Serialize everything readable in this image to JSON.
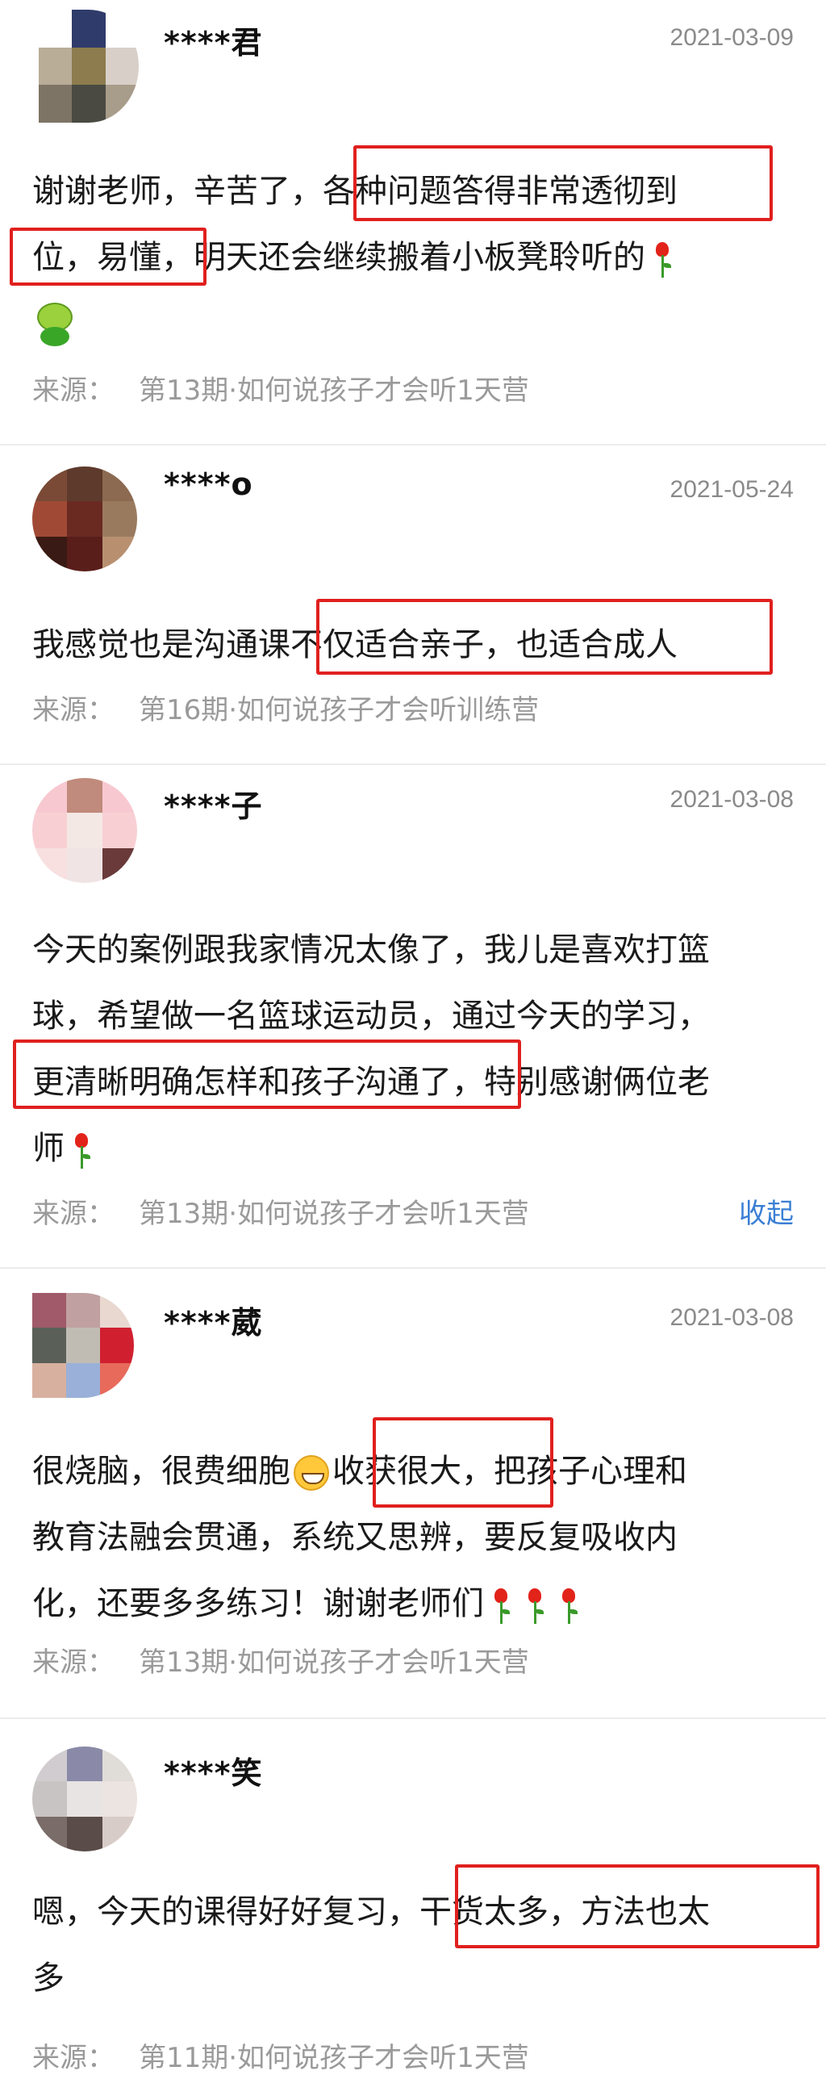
{
  "comments": [
    {
      "name": "****君",
      "date": "2021-03-09",
      "text": "谢谢老师，辛苦了，各种问题答得非常透彻到位，易懂，明天还会继续搬着小板凳聆听的",
      "line1": "谢谢老师，辛苦了，各种问题答得非常透彻到",
      "line2": "位，易懂，明天还会继续搬着小板凳聆听的",
      "source_label": "来源：",
      "source": "第13期·如何说孩子才会听1天营",
      "avatar_colors": [
        "#ffffff",
        "#2f3b6a",
        "#ffffff",
        "#b9ad98",
        "#8c7c4e",
        "#d8d0c8",
        "#7e7466",
        "#4a4a42",
        "#a89c8a"
      ]
    },
    {
      "name": "****o",
      "date": "2021-05-24",
      "line1": "我感觉也是沟通课不仅适合亲子，也适合成人",
      "source_label": "来源：",
      "source": "第16期·如何说孩子才会听训练营",
      "avatar_colors": [
        "#7a4a36",
        "#5e3a2c",
        "#8c6a52",
        "#a04a36",
        "#6a2a22",
        "#9a7a5e",
        "#3a1a14",
        "#5a1e1a",
        "#b89070"
      ]
    },
    {
      "name": "****子",
      "date": "2021-03-08",
      "line1": "今天的案例跟我家情况太像了，我儿是喜欢打篮",
      "line2": "球，希望做一名篮球运动员，通过今天的学习，",
      "line3": "更清晰明确怎样和孩子沟通了，特别感谢俩位老",
      "line4": "师",
      "source_label": "来源：",
      "source": "第13期·如何说孩子才会听1天营",
      "collapse": "收起",
      "avatar_colors": [
        "#f8c8d0",
        "#c08a7c",
        "#f8c8d0",
        "#f8d0d4",
        "#f4e8e4",
        "#f8d0d4",
        "#f8e0e0",
        "#f0e4e4",
        "#6a3a3a"
      ]
    },
    {
      "name": "****葳",
      "date": "2021-03-08",
      "line1": "很烧脑，很费细胞",
      "line1b": "收获很大，把孩子心理和",
      "line2": "教育法融会贯通，系统又思辨，要反复吸收内",
      "line3": "化，还要多多练习！谢谢老师们",
      "source_label": "来源：",
      "source": "第13期·如何说孩子才会听1天营",
      "avatar_colors": [
        "#a05a6a",
        "#c0a0a0",
        "#e8d8d0",
        "#5a6058",
        "#c0bcb4",
        "#d02030",
        "#d8b0a0",
        "#9ab0d8",
        "#e86a5a"
      ]
    },
    {
      "name": "****笑",
      "line1": "嗯，今天的课得好好复习，干货太多，方法也太",
      "line2": "多",
      "source_label": "来源：",
      "source": "第11期·如何说孩子才会听1天营",
      "avatar_colors": [
        "#d0ccd0",
        "#8a8aa8",
        "#e0dcd8",
        "#c8c4c4",
        "#e8e4e4",
        "#ece4e0",
        "#7a6c68",
        "#5a4c48",
        "#d8ccc8"
      ]
    }
  ]
}
